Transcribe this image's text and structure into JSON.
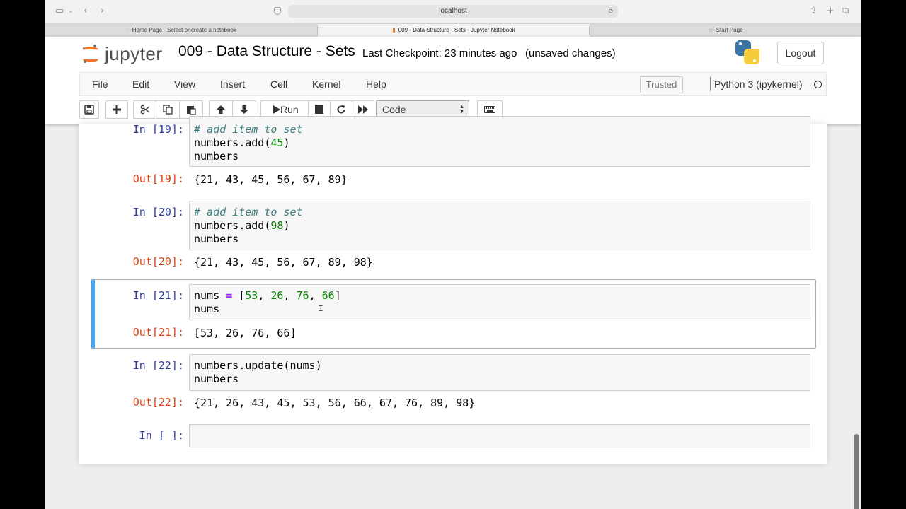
{
  "browser": {
    "url": "localhost",
    "tabs": [
      {
        "label": "Home Page - Select or create a notebook"
      },
      {
        "label": "009 - Data Structure - Sets - Jupyter Notebook"
      },
      {
        "label": "Start Page"
      }
    ]
  },
  "header": {
    "logo_text": "jupyter",
    "notebook_title": "009 - Data Structure - Sets",
    "checkpoint": "Last Checkpoint: 23 minutes ago",
    "unsaved": "(unsaved changes)",
    "logout_label": "Logout"
  },
  "menu": {
    "items": [
      "File",
      "Edit",
      "View",
      "Insert",
      "Cell",
      "Kernel",
      "Help"
    ],
    "trusted": "Trusted",
    "kernel": "Python 3 (ipykernel)"
  },
  "toolbar": {
    "run_label": "Run",
    "cell_type": "Code"
  },
  "cells": [
    {
      "in_prompt": "In [19]:",
      "code": [
        "# add item to set",
        "numbers.add(45)",
        "numbers"
      ],
      "out_prompt": "Out[19]:",
      "output": "{21, 43, 45, 56, 67, 89}"
    },
    {
      "in_prompt": "In [20]:",
      "code": [
        "# add item to set",
        "numbers.add(98)",
        "numbers"
      ],
      "out_prompt": "Out[20]:",
      "output": "{21, 43, 45, 56, 67, 89, 98}"
    },
    {
      "in_prompt": "In [21]:",
      "code": [
        "nums = [53, 26, 76, 66]",
        "nums"
      ],
      "out_prompt": "Out[21]:",
      "output": "[53, 26, 76, 66]"
    },
    {
      "in_prompt": "In [22]:",
      "code": [
        "numbers.update(nums)",
        "numbers"
      ],
      "out_prompt": "Out[22]:",
      "output": "{21, 26, 43, 45, 53, 56, 66, 67, 76, 89, 98}"
    },
    {
      "in_prompt": "In [ ]:",
      "code": []
    }
  ],
  "colors": {
    "in_prompt": "#303f9f",
    "out_prompt": "#d84315",
    "selected_cell_bar": "#42a5f5",
    "logo_orange": "#f37726"
  }
}
